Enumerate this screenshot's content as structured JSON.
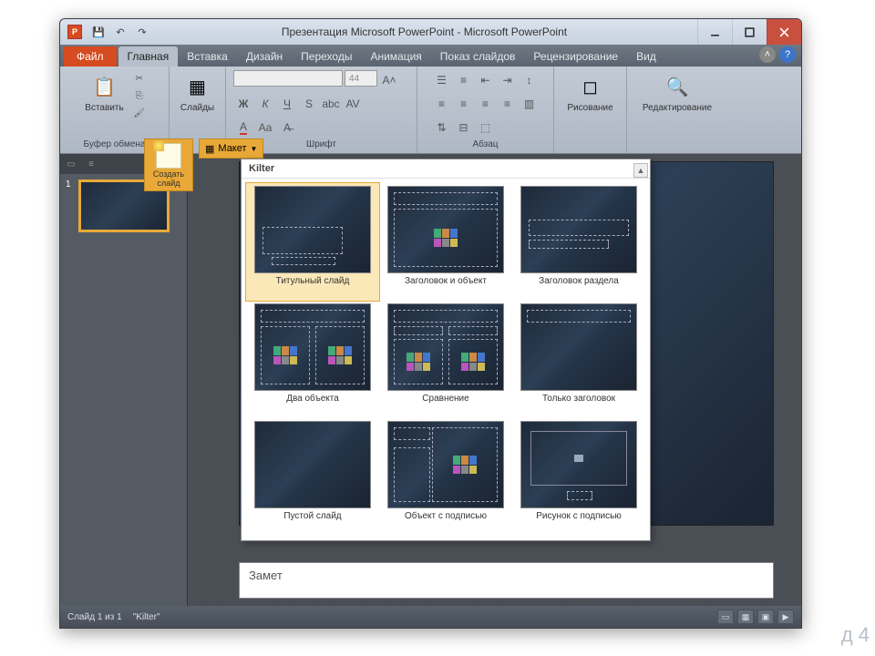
{
  "title": "Презентация Microsoft PowerPoint - Microsoft PowerPoint",
  "qat": {
    "save": "💾",
    "undo": "↶",
    "redo": "↷"
  },
  "tabs": {
    "file": "Файл",
    "items": [
      "Главная",
      "Вставка",
      "Дизайн",
      "Переходы",
      "Анимация",
      "Показ слайдов",
      "Рецензирование",
      "Вид"
    ],
    "activeIndex": 0
  },
  "ribbon": {
    "clipboard": {
      "label": "Буфер обмена",
      "paste": "Вставить"
    },
    "slides": {
      "label": "Слайды"
    },
    "font": {
      "label": "Шрифт",
      "fontname": "",
      "fontsize": "44"
    },
    "paragraph": {
      "label": "Абзац"
    },
    "drawing": {
      "label": "Рисование",
      "btn": "Рисование"
    },
    "editing": {
      "label": "",
      "btn": "Редактирование"
    }
  },
  "newslide": {
    "label": "Создать слайд",
    "layoutBtn": "Макет"
  },
  "gallery": {
    "theme": "Kilter",
    "layouts": [
      "Титульный слайд",
      "Заголовок и объект",
      "Заголовок раздела",
      "Два объекта",
      "Сравнение",
      "Только заголовок",
      "Пустой слайд",
      "Объект с подписью",
      "Рисунок с подписью"
    ],
    "selectedIndex": 0
  },
  "thumbs": {
    "slide1": "1"
  },
  "notes": {
    "placeholder": "Замет"
  },
  "status": {
    "slide": "Слайд 1 из 1",
    "theme": "\"Kilter\""
  },
  "corner": "д 4"
}
